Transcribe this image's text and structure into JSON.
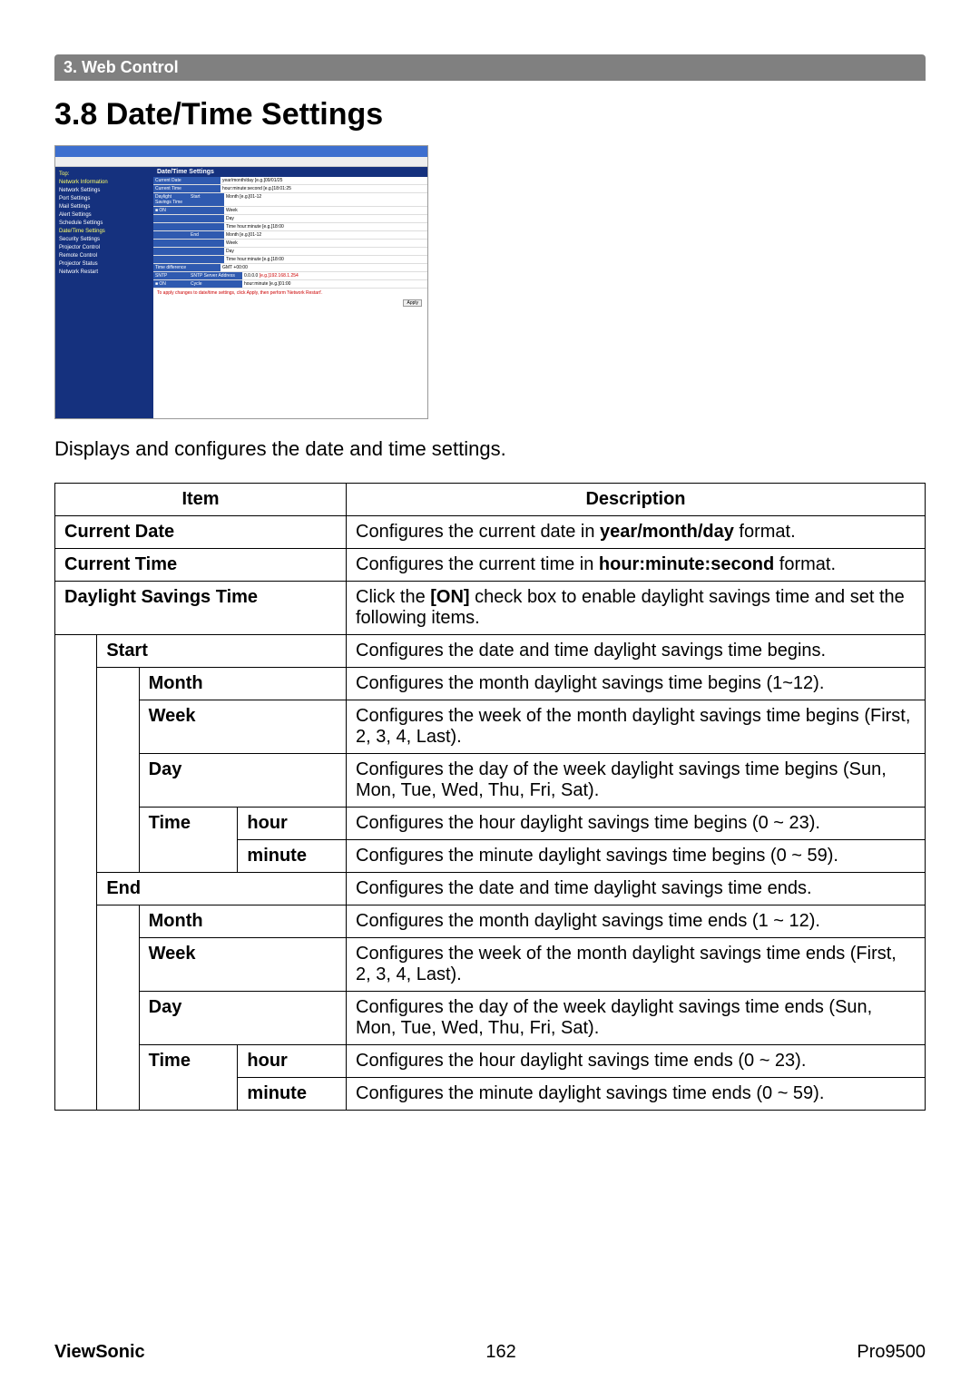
{
  "section_bar": "3. Web Control",
  "heading": "3.8 Date/Time Settings",
  "intro": "Displays and configures the date and time settings.",
  "screenshot": {
    "panel_title": "Date/Time Settings",
    "sidebar": {
      "top": "Top:",
      "net_info": "Network Information",
      "items": [
        "Network Settings",
        "Port Settings",
        "Mail Settings",
        "Alert Settings",
        "Schedule Settings",
        "Date/Time Settings",
        "Security Settings",
        "Projector Control",
        "Remote Control",
        "Projector Status",
        "Network Restart"
      ],
      "selected_index": 5
    },
    "rows": {
      "current_date": "Current Date",
      "current_time": "Current Time",
      "dst": "Daylight Savings Time",
      "on": "■ ON",
      "start": "Start",
      "end": "End",
      "month": "Month",
      "week": "Week",
      "day": "Day",
      "time": "Time",
      "time_diff": "Time difference",
      "gmt": "GMT",
      "sntp": "SNTP",
      "sntp_addr": "SNTP Server Address",
      "cycle": "Cycle",
      "eg_date": "[e.g.]09/01/25",
      "eg_time": "[e.g.]18:01:25",
      "eg_month": "[e.g.]01-12",
      "eg_t": "hour:minute  [e.g.]18:00",
      "eg_ip": "[e.g.]192.168.1.254",
      "eg_cycle": "hour:minute  [e.g.]01:00"
    },
    "note": "To apply changes to date/time settings, click Apply, then perform 'Network Restart'.",
    "apply": "Apply"
  },
  "table": {
    "headers": {
      "item": "Item",
      "description": "Description"
    },
    "rows": [
      {
        "item": "Current Date",
        "desc_pre": "Configures the current date in ",
        "desc_bold": "year/month/day",
        "desc_post": " format."
      },
      {
        "item": "Current Time",
        "desc_pre": "Configures the current time in ",
        "desc_bold": "hour:minute:second",
        "desc_post": " format."
      },
      {
        "item": "Daylight Savings Time",
        "desc_pre": "Click the ",
        "desc_bold": "[ON]",
        "desc_post": " check box to enable daylight savings time and set the following items."
      }
    ],
    "start_row": {
      "item": "Start",
      "desc": "Configures the date and time daylight savings time begins."
    },
    "start_sub": {
      "month": {
        "item": "Month",
        "desc": "Configures the month daylight savings time begins (1~12)."
      },
      "week": {
        "item": "Week",
        "desc": "Configures the week of the month daylight savings time begins (First, 2, 3, 4, Last)."
      },
      "day": {
        "item": "Day",
        "desc": "Configures the day of the week daylight savings time begins (Sun, Mon, Tue, Wed, Thu, Fri, Sat)."
      },
      "time": {
        "item": "Time"
      },
      "hour": {
        "item": "hour",
        "desc": "Configures the hour daylight savings time begins (0 ~ 23)."
      },
      "minute": {
        "item": "minute",
        "desc": "Configures the minute daylight savings time begins (0 ~ 59)."
      }
    },
    "end_row": {
      "item": "End",
      "desc": "Configures the date and time daylight savings time ends."
    },
    "end_sub": {
      "month": {
        "item": "Month",
        "desc": "Configures the month daylight savings time ends (1 ~ 12)."
      },
      "week": {
        "item": "Week",
        "desc": "Configures the week of the month daylight savings time ends (First, 2, 3, 4, Last)."
      },
      "day": {
        "item": "Day",
        "desc": "Configures the day of the week daylight savings time ends (Sun, Mon, Tue, Wed, Thu, Fri, Sat)."
      },
      "time": {
        "item": "Time"
      },
      "hour": {
        "item": "hour",
        "desc": "Configures the hour daylight savings time ends (0 ~ 23)."
      },
      "minute": {
        "item": "minute",
        "desc": "Configures the minute daylight savings time ends (0 ~ 59)."
      }
    }
  },
  "footer": {
    "brand": "ViewSonic",
    "page": "162",
    "model": "Pro9500"
  }
}
